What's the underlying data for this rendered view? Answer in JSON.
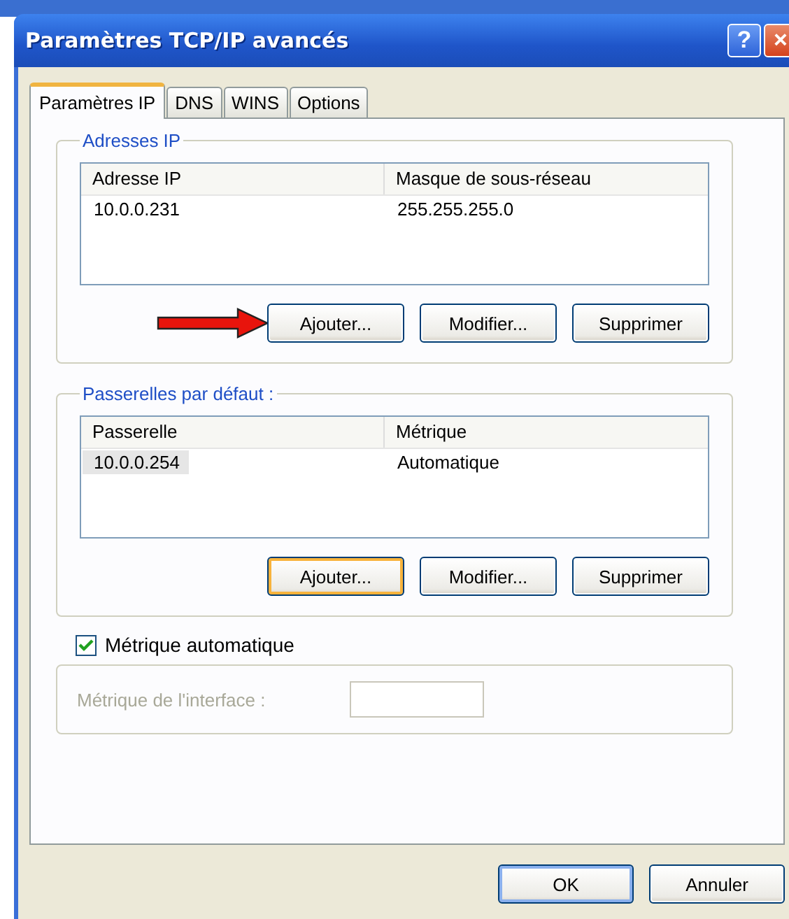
{
  "window": {
    "title": "Paramètres TCP/IP avancés",
    "buttons": [
      "?",
      "×"
    ]
  },
  "tabs": [
    {
      "label": "Paramètres IP",
      "selected": true
    },
    {
      "label": "DNS",
      "selected": false
    },
    {
      "label": "WINS",
      "selected": false
    },
    {
      "label": "Options",
      "selected": false
    }
  ],
  "groups": [
    {
      "title": "Adresses IP",
      "columns": [
        "Adresse IP",
        "Masque de sous-réseau"
      ],
      "rows": [
        {
          "cells": [
            "10.0.0.231",
            "255.255.255.0"
          ],
          "selected": false
        }
      ],
      "arrow": true,
      "buttons": [
        {
          "label": "Ajouter...",
          "focused": false
        },
        {
          "label": "Modifier...",
          "focused": false
        },
        {
          "label": "Supprimer",
          "focused": false
        }
      ]
    },
    {
      "title": "Passerelles par défaut :",
      "columns": [
        "Passerelle",
        "Métrique"
      ],
      "rows": [
        {
          "cells": [
            "10.0.0.254",
            "Automatique"
          ],
          "selected": true
        }
      ],
      "arrow": false,
      "buttons": [
        {
          "label": "Ajouter...",
          "focused": true
        },
        {
          "label": "Modifier...",
          "focused": false
        },
        {
          "label": "Supprimer",
          "focused": false
        }
      ]
    }
  ],
  "auto_metric": {
    "label": "Métrique automatique",
    "checked": true
  },
  "interface_metric": {
    "label": "Métrique de l'interface :",
    "disabled": true
  },
  "dialog_buttons": [
    {
      "label": "OK",
      "default": true
    },
    {
      "label": "Annuler",
      "default": false
    }
  ]
}
